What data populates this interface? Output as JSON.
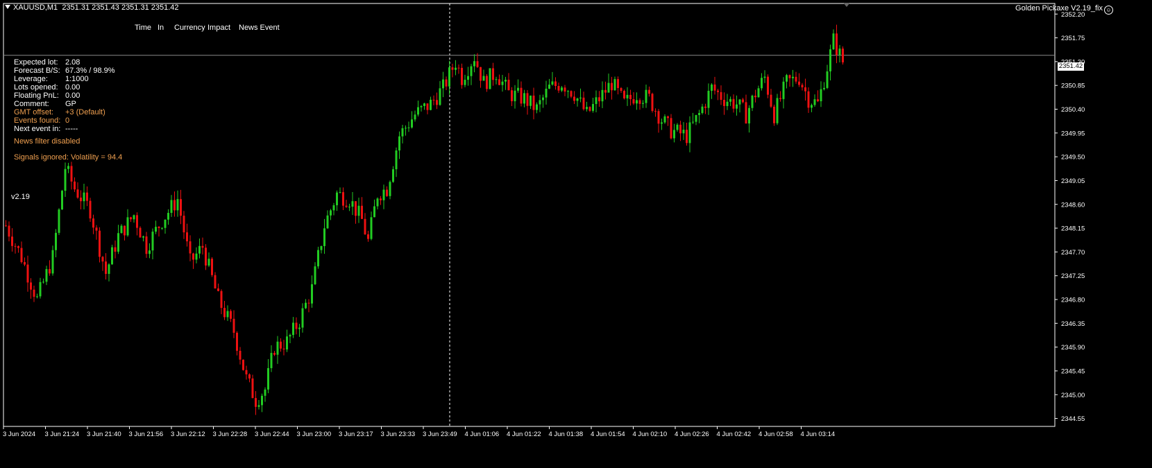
{
  "header": {
    "symbol": "XAUUSD,M1",
    "ohlc": "2351.31 2351.43 2351.31 2351.42"
  },
  "ea": {
    "name": "Golden Pickaxe V2.19_fix",
    "icon": "smiley-icon"
  },
  "news_columns": [
    "Time",
    "In",
    "Currency",
    "Impact",
    "News Event"
  ],
  "info_rows": [
    {
      "label": "Expected lot:",
      "value": "2.08",
      "color": "white"
    },
    {
      "label": "Forecast B/S:",
      "value": "67.3% / 98.9%",
      "color": "white"
    },
    {
      "label": "Leverage:",
      "value": "1:1000",
      "color": "white"
    },
    {
      "label": "Lots opened:",
      "value": "0.00",
      "color": "white"
    },
    {
      "label": "Floating PnL:",
      "value": "0.00",
      "color": "white"
    },
    {
      "label": "Comment:",
      "value": "GP",
      "color": "white"
    },
    {
      "label": "GMT offset:",
      "value": "+3 (Default)",
      "color": "orange"
    },
    {
      "label": "Events found:",
      "value": "0",
      "color": "orange"
    },
    {
      "label": "Next event in:",
      "value": "-----",
      "color": "white"
    }
  ],
  "news_filter": "News filter disabled",
  "signals": "Signals ignored: Volatility = 94.4",
  "version": "v2.19",
  "current_price": "2351.42",
  "colors": {
    "bull": "#22cc22",
    "bear": "#ee1111",
    "axis": "#ffffff",
    "orange": "#f0a050"
  },
  "chart_data": {
    "type": "candlestick",
    "ylim": [
      2344.4,
      2352.4
    ],
    "y_ticks": [
      "2352.20",
      "2351.75",
      "2351.30",
      "2350.85",
      "2350.40",
      "2349.95",
      "2349.50",
      "2349.05",
      "2348.60",
      "2348.15",
      "2347.70",
      "2347.25",
      "2346.80",
      "2346.35",
      "2345.90",
      "2345.45",
      "2345.00",
      "2344.55"
    ],
    "x_labels": [
      "3 Jun 2024",
      "3 Jun 21:24",
      "3 Jun 21:40",
      "3 Jun 21:56",
      "3 Jun 22:12",
      "3 Jun 22:28",
      "3 Jun 22:44",
      "3 Jun 23:00",
      "3 Jun 23:17",
      "3 Jun 23:33",
      "3 Jun 23:49",
      "4 Jun 01:06",
      "4 Jun 01:22",
      "4 Jun 01:38",
      "4 Jun 01:54",
      "4 Jun 02:10",
      "4 Jun 02:26",
      "4 Jun 02:42",
      "4 Jun 02:58",
      "4 Jun 03:14"
    ],
    "current_price": 2351.42,
    "close_path": [
      [
        0,
        2348.2
      ],
      [
        5,
        2347.6
      ],
      [
        10,
        2346.8
      ],
      [
        15,
        2347.6
      ],
      [
        19,
        2349.3
      ],
      [
        22,
        2348.9
      ],
      [
        27,
        2348.5
      ],
      [
        32,
        2347.3
      ],
      [
        36,
        2348.0
      ],
      [
        41,
        2348.4
      ],
      [
        45,
        2347.8
      ],
      [
        50,
        2348.3
      ],
      [
        55,
        2348.7
      ],
      [
        59,
        2347.5
      ],
      [
        63,
        2347.8
      ],
      [
        68,
        2346.8
      ],
      [
        73,
        2346.2
      ],
      [
        77,
        2345.3
      ],
      [
        80,
        2344.9
      ],
      [
        83,
        2345.1
      ],
      [
        86,
        2345.9
      ],
      [
        90,
        2346.0
      ],
      [
        94,
        2346.4
      ],
      [
        98,
        2347.0
      ],
      [
        102,
        2348.2
      ],
      [
        106,
        2348.8
      ],
      [
        110,
        2348.7
      ],
      [
        114,
        2348.3
      ],
      [
        116,
        2347.9
      ],
      [
        119,
        2348.8
      ],
      [
        122,
        2348.9
      ],
      [
        126,
        2349.9
      ],
      [
        131,
        2350.3
      ],
      [
        136,
        2350.5
      ],
      [
        140,
        2350.8
      ],
      [
        144,
        2351.3
      ],
      [
        146,
        2351.0
      ],
      [
        150,
        2351.4
      ],
      [
        153,
        2350.9
      ],
      [
        157,
        2351.1
      ],
      [
        161,
        2350.7
      ],
      [
        166,
        2350.6
      ],
      [
        170,
        2350.4
      ],
      [
        174,
        2350.8
      ],
      [
        178,
        2350.9
      ],
      [
        182,
        2350.7
      ],
      [
        186,
        2350.3
      ],
      [
        190,
        2350.6
      ],
      [
        194,
        2350.9
      ],
      [
        198,
        2350.5
      ],
      [
        202,
        2350.7
      ],
      [
        206,
        2350.6
      ],
      [
        210,
        2350.2
      ],
      [
        213,
        2350.0
      ],
      [
        218,
        2349.9
      ],
      [
        222,
        2350.3
      ],
      [
        226,
        2350.8
      ],
      [
        230,
        2350.6
      ],
      [
        234,
        2350.5
      ],
      [
        237,
        2350.3
      ],
      [
        240,
        2350.7
      ],
      [
        243,
        2351.0
      ],
      [
        246,
        2350.3
      ],
      [
        250,
        2350.9
      ],
      [
        254,
        2351.0
      ],
      [
        257,
        2350.6
      ],
      [
        260,
        2350.5
      ],
      [
        263,
        2351.2
      ],
      [
        265,
        2351.7
      ],
      [
        268,
        2351.3
      ]
    ]
  }
}
